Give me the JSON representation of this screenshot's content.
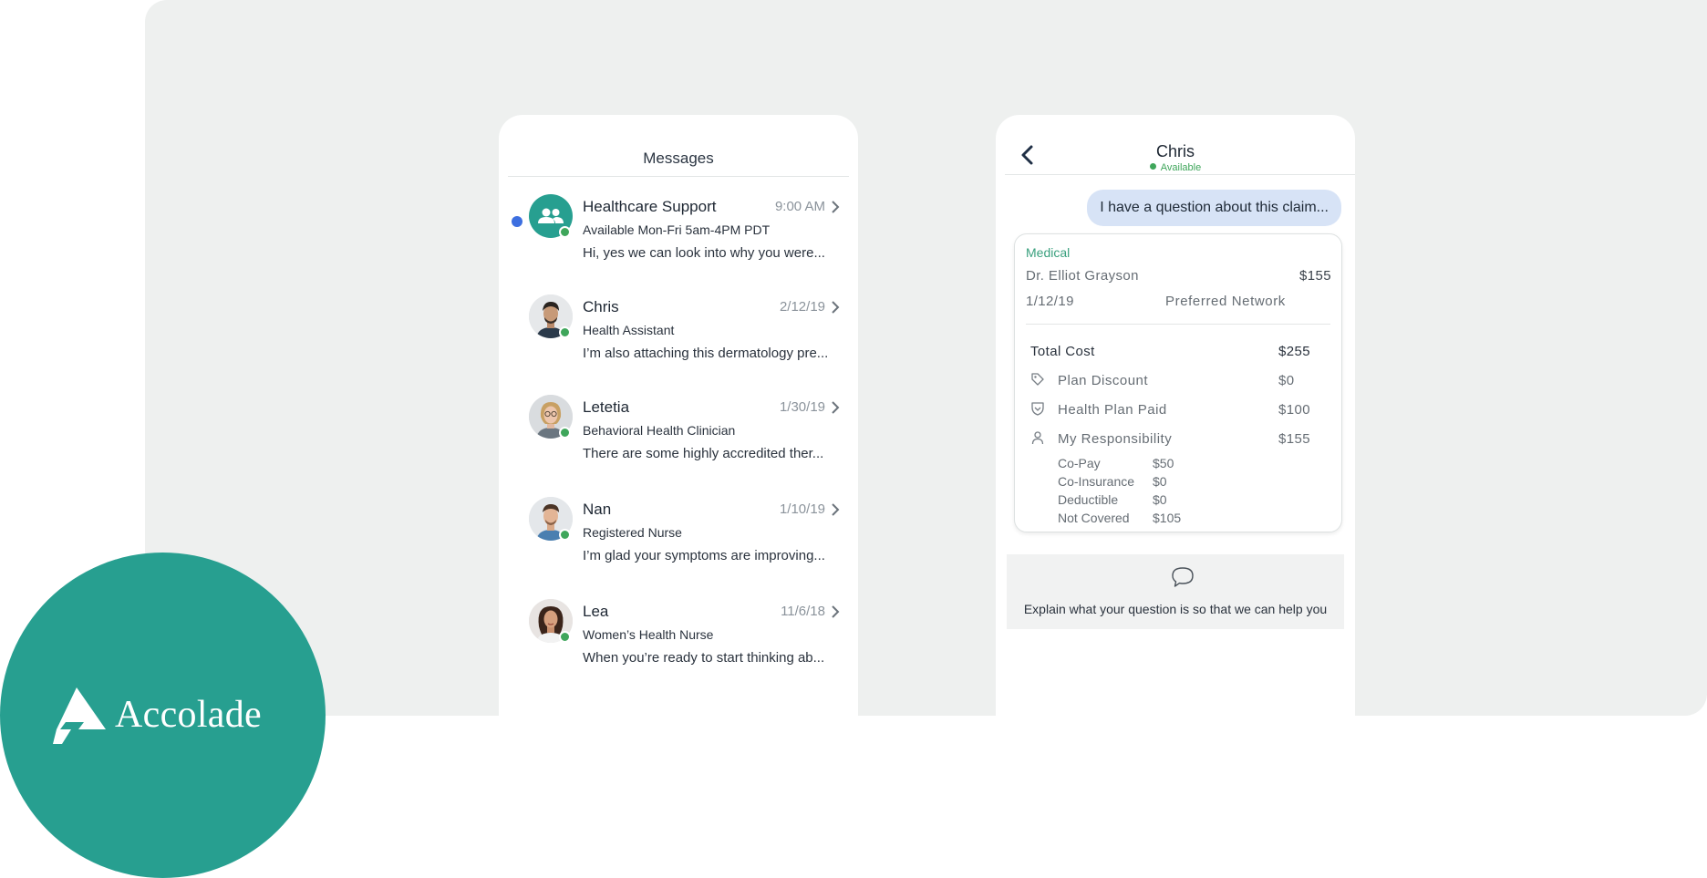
{
  "messages": {
    "title": "Messages",
    "conversations": [
      {
        "name": "Healthcare Support",
        "role": "Available Mon-Fri 5am-4PM PDT",
        "preview": "Hi, yes we can look into why you were...",
        "time": "9:00 AM",
        "unread": true
      },
      {
        "name": "Chris",
        "role": "Health Assistant",
        "preview": "I’m also attaching this dermatology pre...",
        "time": "2/12/19"
      },
      {
        "name": "Letetia",
        "role": "Behavioral Health Clinician",
        "preview": "There are some highly accredited ther...",
        "time": "1/30/19"
      },
      {
        "name": "Nan",
        "role": "Registered Nurse",
        "preview": "I’m glad your symptoms are improving...",
        "time": "1/10/19"
      },
      {
        "name": "Lea",
        "role": "Women’s Health Nurse",
        "preview": "When you’re ready to start thinking ab...",
        "time": "11/6/18"
      }
    ]
  },
  "chat": {
    "name": "Chris",
    "status": "Available",
    "bubble": "I have a question about this claim...",
    "claim": {
      "type": "Medical",
      "provider": "Dr. Elliot Grayson",
      "amount": "$155",
      "date": "1/12/19",
      "network": "Preferred Network",
      "total_label": "Total Cost",
      "total_value": "$255",
      "lines": [
        {
          "label": "Plan Discount",
          "value": "$0",
          "icon": "tag-icon"
        },
        {
          "label": "Health Plan Paid",
          "value": "$100",
          "icon": "shield-icon"
        },
        {
          "label": "My Responsibility",
          "value": "$155",
          "icon": "person-icon"
        }
      ],
      "breakdown": [
        {
          "label": "Co-Pay",
          "value": "$50"
        },
        {
          "label": "Co-Insurance",
          "value": "$0"
        },
        {
          "label": "Deductible",
          "value": "$0"
        },
        {
          "label": "Not Covered",
          "value": "$105"
        }
      ]
    },
    "prompt": "Explain what your question is so that we can help you"
  },
  "brand": {
    "name": "Accolade",
    "color": "#279f90"
  },
  "colors": {
    "accent_green": "#3aa07e",
    "online": "#3fa65b",
    "unread": "#3d6fe0",
    "bubble": "#d7e3f6"
  }
}
